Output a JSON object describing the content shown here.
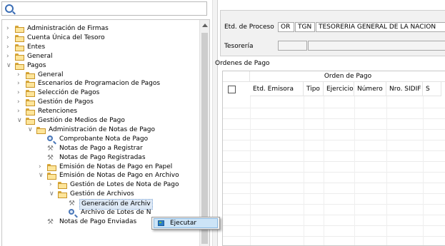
{
  "tree": {
    "items": [
      {
        "label": "Administración de Firmas",
        "depth": 0,
        "state": "collapsed",
        "icon": "folder-icon"
      },
      {
        "label": "Cuenta Única del Tesoro",
        "depth": 0,
        "state": "collapsed",
        "icon": "folder-icon"
      },
      {
        "label": "Entes",
        "depth": 0,
        "state": "collapsed",
        "icon": "folder-icon"
      },
      {
        "label": "General",
        "depth": 0,
        "state": "collapsed",
        "icon": "folder-icon"
      },
      {
        "label": "Pagos",
        "depth": 0,
        "state": "expanded",
        "icon": "folder-icon"
      },
      {
        "label": "General",
        "depth": 1,
        "state": "collapsed",
        "icon": "folder-icon"
      },
      {
        "label": "Escenarios de Programacion de Pagos",
        "depth": 1,
        "state": "collapsed",
        "icon": "folder-icon"
      },
      {
        "label": "Selección de Pagos",
        "depth": 1,
        "state": "collapsed",
        "icon": "folder-icon"
      },
      {
        "label": "Gestión de Pagos",
        "depth": 1,
        "state": "collapsed",
        "icon": "folder-icon"
      },
      {
        "label": "Retenciones",
        "depth": 1,
        "state": "collapsed",
        "icon": "folder-icon"
      },
      {
        "label": "Gestión de Medios de Pago",
        "depth": 1,
        "state": "expanded",
        "icon": "folder-icon"
      },
      {
        "label": "Administración de Notas de Pago",
        "depth": 2,
        "state": "expanded",
        "icon": "folder-icon"
      },
      {
        "label": "Comprobante Nota de Pago",
        "depth": 3,
        "state": "leaf",
        "icon": "magnifier-icon"
      },
      {
        "label": "Notas de Pago a Registrar",
        "depth": 3,
        "state": "leaf",
        "icon": "tools-icon"
      },
      {
        "label": "Notas de Pago Registradas",
        "depth": 3,
        "state": "leaf",
        "icon": "tools-icon"
      },
      {
        "label": "Emisión de Notas de Pago en Papel",
        "depth": 3,
        "state": "collapsed",
        "icon": "folder-icon"
      },
      {
        "label": "Emisión de Notas de Pago en Archivo",
        "depth": 3,
        "state": "expanded",
        "icon": "folder-icon"
      },
      {
        "label": "Gestión de Lotes de Nota de Pago",
        "depth": 4,
        "state": "collapsed",
        "icon": "folder-icon"
      },
      {
        "label": "Gestión de Archivos",
        "depth": 4,
        "state": "expanded",
        "icon": "folder-icon"
      },
      {
        "label": "Generación de Archiv",
        "depth": 5,
        "state": "leaf",
        "icon": "tools-icon",
        "selected": true
      },
      {
        "label": "Archivo de Lotes de N",
        "depth": 5,
        "state": "leaf",
        "icon": "magnifier-icon"
      },
      {
        "label": "Notas de Pago Enviadas",
        "depth": 3,
        "state": "leaf",
        "icon": "tools-icon"
      }
    ]
  },
  "context_menu": {
    "item_label": "Ejecutar",
    "icon": "run-icon"
  },
  "form": {
    "etd_proceso_label": "Etd. de Proceso",
    "etd_code1": "OR",
    "etd_code2": "TGN",
    "etd_desc": "TESORERIA GENERAL DE LA NACION",
    "tesoreria_label": "Tesorería",
    "tesoreria_value1": "",
    "tesoreria_value2": ""
  },
  "orders": {
    "title": "Ordenes de Pago",
    "group_header": "Orden de Pago",
    "columns": [
      "Etd. Emisora",
      "Tipo",
      "Ejercicio",
      "Número",
      "Nro. SIDIF",
      "S"
    ]
  },
  "colors": {
    "selection": "#cce4f7",
    "folder": "#fde59a"
  }
}
